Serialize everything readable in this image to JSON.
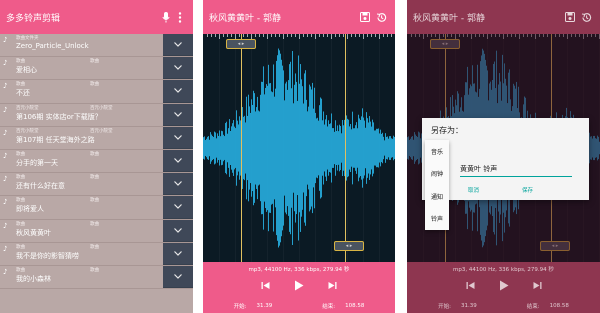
{
  "screen1": {
    "title": "多多铃声剪辑",
    "icons": {
      "mic": "mic-icon",
      "more": "more-vert-icon"
    },
    "items": [
      {
        "meta_left": "歌曲文件夹",
        "meta_right": "",
        "name": "Zero_Particle_Unlock"
      },
      {
        "meta_left": "歌曲",
        "meta_right": "歌曲",
        "name": "爱相心"
      },
      {
        "meta_left": "歌曲",
        "meta_right": "歌曲",
        "name": "不还"
      },
      {
        "meta_left": "百元小院堂",
        "meta_right": "百元小院堂",
        "name": "第106期 实体店or下载版？"
      },
      {
        "meta_left": "百元小院堂",
        "meta_right": "百元小院堂",
        "name": "第107期 任天堂海外之路"
      },
      {
        "meta_left": "歌曲",
        "meta_right": "歌曲",
        "name": "分手的第一天"
      },
      {
        "meta_left": "歌曲",
        "meta_right": "歌曲",
        "name": "还有什么好在意"
      },
      {
        "meta_left": "歌曲",
        "meta_right": "歌曲",
        "name": "即将爱人"
      },
      {
        "meta_left": "歌曲",
        "meta_right": "歌曲",
        "name": "秋风黄黄叶"
      },
      {
        "meta_left": "歌曲",
        "meta_right": "歌曲",
        "name": "我不是你的影智猜唠"
      },
      {
        "meta_left": "歌曲",
        "meta_right": "歌曲",
        "name": "我的小森林"
      }
    ]
  },
  "editor": {
    "title": "秋风黄黄叶 - 郭静",
    "format_info": "mp3, 44100 Hz, 336 kbps, 279.94 秒",
    "start_label": "开始:",
    "start_value": "31.39",
    "end_label": "结束:",
    "end_value": "108.58",
    "icons": {
      "save": "save-icon",
      "reset": "history-icon",
      "prev": "skip-previous-icon",
      "play": "play-icon",
      "next": "skip-next-icon"
    }
  },
  "dialog": {
    "title": "另存为：",
    "filename": "黄黄叶 铃声",
    "cancel": "取消",
    "save": "保存",
    "type_options": [
      "音乐",
      "闹钟",
      "通知",
      "铃声"
    ]
  },
  "colors": {
    "accent": "#ef5b8a",
    "accent_dim": "#8e3650",
    "wave": "#27aee0",
    "wave_bg": "#0b1a24",
    "handle": "#d8b444",
    "teal": "#00a39b"
  }
}
